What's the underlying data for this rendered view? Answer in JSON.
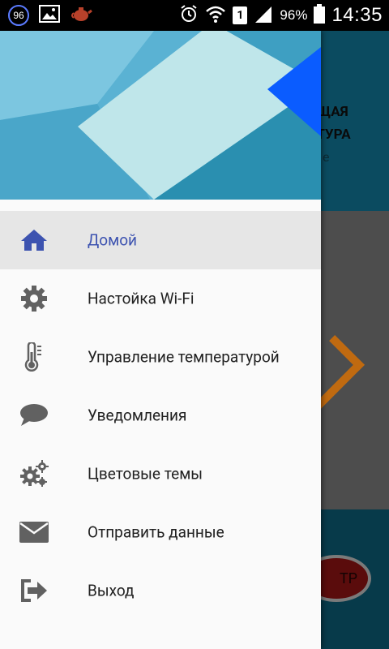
{
  "status_bar": {
    "notification_badge": "96",
    "battery_percent": "96%",
    "sim_slot": "1",
    "time": "14:35"
  },
  "background_app": {
    "title_line1": "УЩАЯ",
    "title_line2": "АТУРА",
    "subtitle": "е",
    "button_text": "ТР"
  },
  "drawer": {
    "menu_items": [
      {
        "label": "Домой",
        "icon": "home-icon",
        "selected": true
      },
      {
        "label": "Настойка Wi-Fi",
        "icon": "gear-icon",
        "selected": false
      },
      {
        "label": "Управление температурой",
        "icon": "thermometer-icon",
        "selected": false
      },
      {
        "label": "Уведомления",
        "icon": "chat-bubble-icon",
        "selected": false
      },
      {
        "label": "Цветовые темы",
        "icon": "gears-icon",
        "selected": false
      },
      {
        "label": "Отправить данные",
        "icon": "envelope-icon",
        "selected": false
      },
      {
        "label": "Выход",
        "icon": "logout-icon",
        "selected": false
      }
    ]
  },
  "colors": {
    "accent": "#3d53b0",
    "icon_gray": "#616161",
    "selected_bg": "#e6e6e6"
  }
}
